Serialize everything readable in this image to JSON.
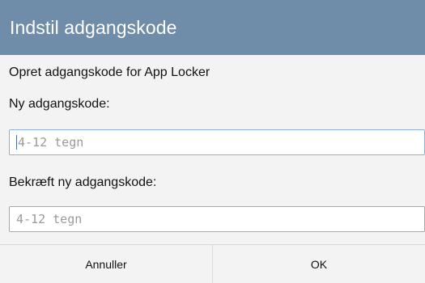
{
  "dialog": {
    "title": "Indstil adgangskode",
    "description": "Opret adgangskode for App Locker",
    "new_password_label": "Ny adgangskode:",
    "new_password_placeholder": "4-12 tegn",
    "confirm_password_label": "Bekræft ny adgangskode:",
    "confirm_password_placeholder": "4-12 tegn",
    "cancel_label": "Annuller",
    "ok_label": "OK"
  },
  "colors": {
    "titlebar": "#6f8ca8",
    "focus_border": "#8fb0d6",
    "background": "#f3f3f3"
  }
}
